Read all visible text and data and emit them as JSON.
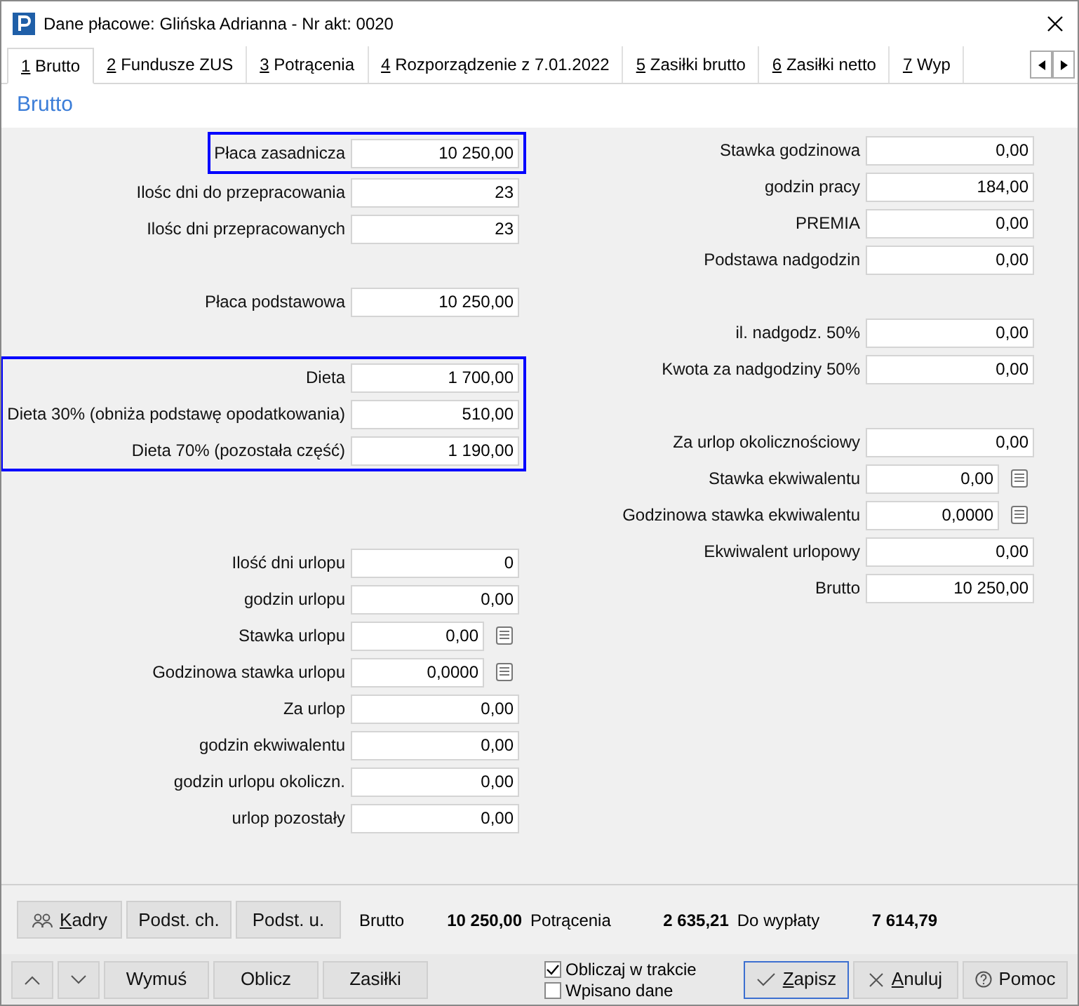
{
  "window": {
    "title": "Dane płacowe: Glińska Adrianna - Nr akt: 0020"
  },
  "tabs": [
    {
      "key": "1",
      "label": "Brutto",
      "selected": true
    },
    {
      "key": "2",
      "label": "Fundusze ZUS",
      "selected": false
    },
    {
      "key": "3",
      "label": "Potrącenia",
      "selected": false
    },
    {
      "key": "4",
      "label": "Rozporządzenie z 7.01.2022",
      "selected": false
    },
    {
      "key": "5",
      "label": "Zasiłki brutto",
      "selected": false
    },
    {
      "key": "6",
      "label": "Zasiłki netto",
      "selected": false
    },
    {
      "key": "7",
      "label": "Wyp",
      "selected": false
    }
  ],
  "section_title": "Brutto",
  "left_sections": [
    {
      "highlighted": true,
      "fields": [
        {
          "label": "Płaca zasadnicza",
          "value": "10 250,00"
        }
      ]
    },
    {
      "highlighted": false,
      "fields": [
        {
          "label": "Ilośc dni do przepracowania",
          "value": "23"
        },
        {
          "label": "Ilośc dni przepracowanych",
          "value": "23"
        }
      ]
    },
    {
      "highlighted": false,
      "fields": [
        {
          "label": "Płaca podstawowa",
          "value": "10 250,00"
        }
      ]
    },
    {
      "highlighted": true,
      "fields": [
        {
          "label": "Dieta",
          "value": "1 700,00"
        },
        {
          "label": "Dieta 30% (obniża podstawę opodatkowania)",
          "value": "510,00"
        },
        {
          "label": "Dieta 70% (pozostała część)",
          "value": "1 190,00"
        }
      ]
    },
    {
      "highlighted": false,
      "fields": [
        {
          "label": "Ilość dni urlopu",
          "value": "0"
        },
        {
          "label": "godzin urlopu",
          "value": "0,00"
        },
        {
          "label": "Stawka urlopu",
          "value": "0,00",
          "icon": true
        },
        {
          "label": "Godzinowa stawka urlopu",
          "value": "0,0000",
          "icon": true
        },
        {
          "label": "Za urlop",
          "value": "0,00"
        },
        {
          "label": "godzin ekwiwalentu",
          "value": "0,00"
        },
        {
          "label": "godzin urlopu okoliczn.",
          "value": "0,00"
        },
        {
          "label": "urlop pozostały",
          "value": "0,00"
        }
      ]
    }
  ],
  "right_sections": [
    {
      "highlighted": false,
      "fields": [
        {
          "label": "Stawka godzinowa",
          "value": "0,00"
        },
        {
          "label": "godzin pracy",
          "value": "184,00"
        },
        {
          "label": "PREMIA",
          "value": "0,00"
        },
        {
          "label": "Podstawa nadgodzin",
          "value": "0,00"
        }
      ]
    },
    {
      "highlighted": false,
      "fields": [
        {
          "label": "il. nadgodz. 50%",
          "value": "0,00"
        },
        {
          "label": "Kwota za nadgodziny 50%",
          "value": "0,00"
        }
      ]
    },
    {
      "highlighted": false,
      "fields": [
        {
          "label": "Za urlop okolicznościowy",
          "value": "0,00"
        },
        {
          "label": "Stawka ekwiwalentu",
          "value": "0,00",
          "icon": true
        },
        {
          "label": "Godzinowa stawka ekwiwalentu",
          "value": "0,0000",
          "icon": true
        },
        {
          "label": "Ekwiwalent urlopowy",
          "value": "0,00"
        },
        {
          "label": "Brutto",
          "value": "10 250,00"
        }
      ]
    }
  ],
  "footer_buttons": [
    {
      "label": "Kadry",
      "kind": "staff",
      "underline_first": true
    },
    {
      "label": "Podst. ch.",
      "kind": "plain",
      "underline_first": false
    },
    {
      "label": "Podst. u.",
      "kind": "plain",
      "underline_first": false
    }
  ],
  "totals": [
    {
      "label": "Brutto",
      "value": "10 250,00"
    },
    {
      "label": "Potrącenia",
      "value": "2 635,21"
    },
    {
      "label": "Do wypłaty",
      "value": "7 614,79"
    }
  ],
  "action_buttons": [
    "Wymuś",
    "Oblicz",
    "Zasiłki"
  ],
  "checkboxes": [
    {
      "label": "Obliczaj w trakcie",
      "checked": true
    },
    {
      "label": "Wpisano dane",
      "checked": false
    }
  ],
  "dialog_buttons": [
    {
      "kind": "ok",
      "label": "Zapisz",
      "underline_first": true,
      "default": true
    },
    {
      "kind": "cancel",
      "label": "Anuluj",
      "underline_first": true,
      "default": false
    },
    {
      "kind": "help",
      "label": "Pomoc",
      "underline_first": false,
      "default": false
    }
  ]
}
